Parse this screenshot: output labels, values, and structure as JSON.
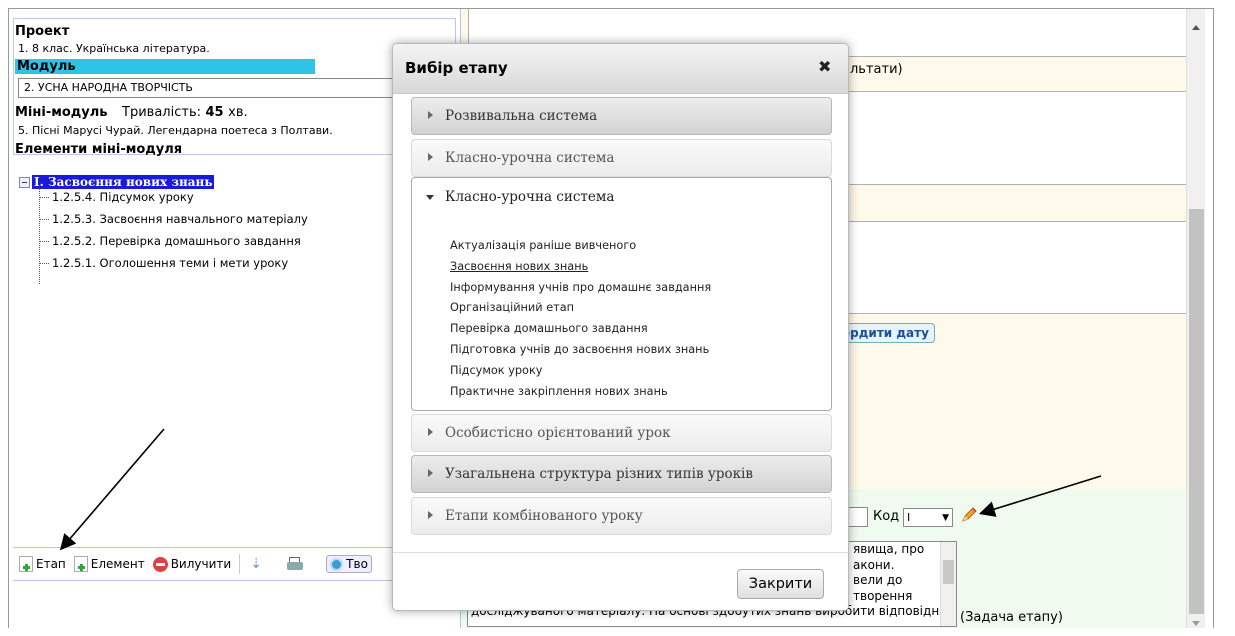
{
  "left": {
    "project_label": "Проект",
    "project_value": "1. 8 клас. Українська література.",
    "module_label": "Модуль",
    "module_value": "2. УСНА НАРОДНА ТВОРЧІСТЬ",
    "minimodule_label": "Міні-модуль",
    "duration_label": "Тривалість:",
    "duration_value": "45",
    "duration_unit": "хв.",
    "minimodule_value": "5. Пісні Марусі Чурай. Легендарна поетеса з Полтави.",
    "elements_label": "Елементи міні-модуля",
    "tree_root": "I. Засвоєння нових знань",
    "tree_items": [
      "1.2.5.4. Підсумок уроку",
      "1.2.5.3. Засвоєння навчального матеріалу",
      "1.2.5.2. Перевірка домашнього завдання",
      "1.2.5.1. Оголошення теми і мети уроку"
    ],
    "toolbar": {
      "stage": "Етап",
      "element": "Елемент",
      "delete": "Вилучити",
      "create": "Тво"
    }
  },
  "right": {
    "results_fragment": "льтати)",
    "confirm_date": "ердити дату",
    "code_label": "Код",
    "code_select": "I",
    "memo_lines": [
      "явища, про",
      "акони.",
      "вели до",
      "творення",
      "досліджуваного матеріалу. На основі здобутих знань виробити відповідні"
    ],
    "task_label": "(Задача етапу)"
  },
  "modal": {
    "title": "Вибір етапу",
    "close_label": "Закрити",
    "accordion": [
      {
        "label": "Розвивальна система",
        "state": "collapsed"
      },
      {
        "label": "Класно-урочна система",
        "state": "collapsed"
      },
      {
        "label": "Класно-урочна система",
        "state": "expanded"
      },
      {
        "label": "Особистісно орієнтований урок",
        "state": "collapsed"
      },
      {
        "label": "Узагальнена структура різних типів уроків",
        "state": "collapsed"
      },
      {
        "label": "Етапи комбінованого уроку",
        "state": "collapsed"
      }
    ],
    "expanded_items": [
      "Актуалізація раніше вивченого",
      "Засвоєння нових знань",
      "Інформування учнів про домашнє завдання",
      "Організаційний етап",
      "Перевірка домашнього завдання",
      "Підготовка учнів до засвоєння нових знань",
      "Підсумок уроку",
      "Практичне закріплення нових знань"
    ]
  },
  "colors": {
    "module_highlight": "#2ec4e8",
    "tree_selected": "#1a1adb",
    "right_yellow_bg": "#fff9ec",
    "right_green_bg": "#eefbee"
  },
  "icons": [
    "close-icon",
    "plus-icon",
    "delete-icon",
    "move-down-icon",
    "print-icon",
    "gear-icon",
    "pencil-icon",
    "chevron-right-icon",
    "chevron-down-icon"
  ]
}
